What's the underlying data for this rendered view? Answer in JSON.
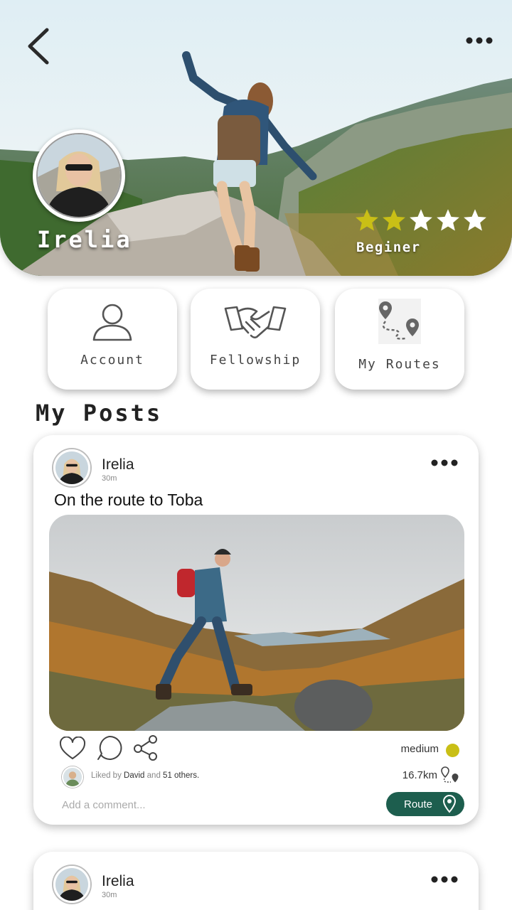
{
  "profile": {
    "name": "Irelia",
    "level": "Beginer",
    "rating": 2,
    "rating_max": 5,
    "star_filled_color": "#c9bf16",
    "star_empty_color": "#ffffff"
  },
  "icons": {
    "back": "chevron-left-icon",
    "more": "more-horizontal-icon",
    "account": "user-icon",
    "fellowship": "handshake-icon",
    "routes": "route-map-icon",
    "like": "heart-icon",
    "comment": "comment-icon",
    "share": "share-icon",
    "route": "location-pin-icon"
  },
  "tiles": [
    {
      "label": "Account"
    },
    {
      "label": "Fellowship"
    },
    {
      "label": "My Routes"
    }
  ],
  "section_title": "My Posts",
  "posts": [
    {
      "author": "Irelia",
      "time": "30m",
      "title": "On the route to Toba",
      "difficulty": "medium",
      "difficulty_color": "#c9bf16",
      "liked_prefix": "Liked by",
      "liked_user": "David",
      "liked_and": "and",
      "liked_others": "51 others.",
      "distance": "16.7km",
      "comment_placeholder": "Add a comment...",
      "route_label": "Route",
      "route_color": "#1d5e4e"
    },
    {
      "author": "Irelia",
      "time": "30m"
    }
  ]
}
